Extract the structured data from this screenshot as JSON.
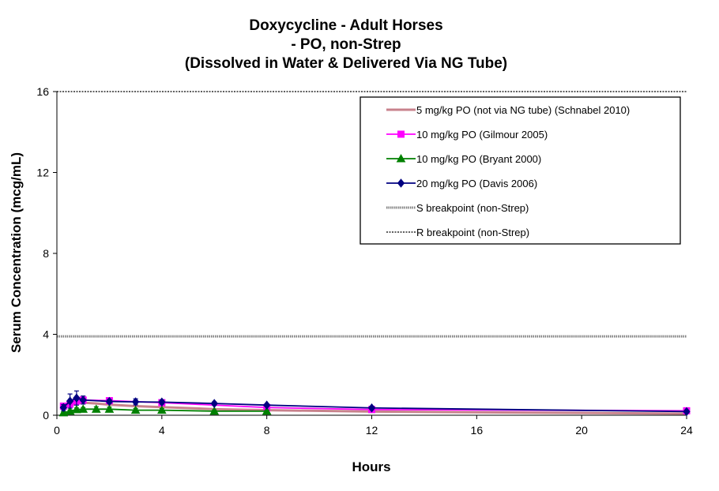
{
  "chart_data": {
    "type": "line",
    "title_lines": [
      "Doxycycline  - Adult Horses",
      "- PO, non-Strep",
      "(Dissolved in Water & Delivered Via NG Tube)"
    ],
    "xlabel": "Hours",
    "ylabel": "Serum Concentration (mcg/mL)",
    "xlim": [
      0,
      24
    ],
    "ylim": [
      0,
      16
    ],
    "xticks": [
      0,
      4,
      8,
      12,
      16,
      20,
      24
    ],
    "yticks": [
      0,
      4,
      8,
      12,
      16
    ],
    "legend_position": "top-right",
    "grid": false,
    "series": [
      {
        "name": "5 mg/kg PO (not via NG tube) (Schnabel 2010)",
        "color": "#c8828c",
        "marker": "none",
        "x": [
          0.25,
          0.5,
          1,
          1.5,
          2,
          3,
          4,
          6,
          8,
          12,
          24
        ],
        "y": [
          0.35,
          0.5,
          0.62,
          0.58,
          0.52,
          0.45,
          0.4,
          0.3,
          0.25,
          0.18,
          0.08
        ]
      },
      {
        "name": "10 mg/kg PO (Gilmour 2005)",
        "color": "#ff00ff",
        "marker": "square",
        "x": [
          0.25,
          0.5,
          0.75,
          1,
          2,
          4,
          8,
          12,
          24
        ],
        "y": [
          0.45,
          0.55,
          0.7,
          0.75,
          0.72,
          0.62,
          0.38,
          0.28,
          0.22
        ],
        "yerr": [
          0.05,
          0.05,
          0.05,
          0.05,
          0.05,
          0.05,
          0.05,
          0.05,
          0.1
        ]
      },
      {
        "name": "10 mg/kg PO (Bryant 2000)",
        "color": "#008000",
        "marker": "triangle",
        "x": [
          0.25,
          0.5,
          0.75,
          1,
          1.5,
          2,
          3,
          4,
          6,
          8
        ],
        "y": [
          0.12,
          0.2,
          0.28,
          0.3,
          0.3,
          0.3,
          0.25,
          0.25,
          0.2,
          0.2
        ],
        "yerr": [
          0.05,
          0.06,
          0.08,
          0.08,
          0.12,
          0.1,
          0.08,
          0.08,
          0.06,
          0.05
        ]
      },
      {
        "name": "20 mg/kg PO (Davis 2006)",
        "color": "#000080",
        "marker": "diamond",
        "x": [
          0.25,
          0.5,
          0.75,
          1,
          2,
          3,
          4,
          6,
          8,
          12,
          24
        ],
        "y": [
          0.38,
          0.7,
          0.85,
          0.75,
          0.68,
          0.66,
          0.65,
          0.58,
          0.5,
          0.36,
          0.18
        ],
        "yerr": [
          0.15,
          0.35,
          0.35,
          0.2,
          0.1,
          0.15,
          0.1,
          0.08,
          0.05,
          0.08,
          0.05
        ]
      }
    ],
    "reference_lines": [
      {
        "name": "S breakpoint (non-Strep)",
        "y": 3.9,
        "style": "dotted-gray",
        "color": "#808080"
      },
      {
        "name": "R breakpoint (non-Strep)",
        "y": 16,
        "style": "dotted-black",
        "color": "#000000"
      }
    ]
  }
}
